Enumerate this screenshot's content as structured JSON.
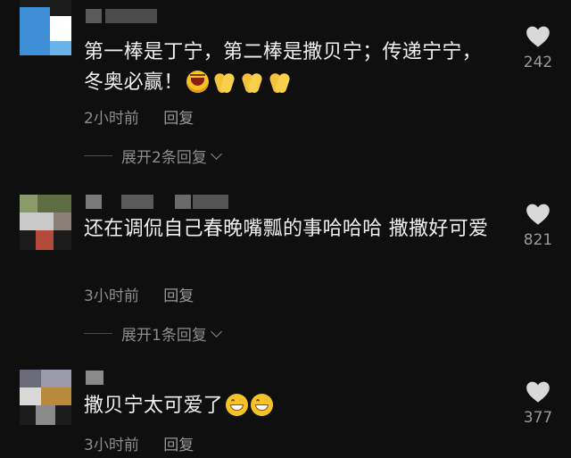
{
  "comments": [
    {
      "text": "第一棒是丁宁，第二棒是撒贝宁；传递宁宁，冬奥必赢！",
      "emojis": [
        "laugh-emoji",
        "clap-emoji",
        "clap-emoji",
        "clap-emoji"
      ],
      "time": "2小时前",
      "reply": "回复",
      "expand": "展开2条回复",
      "likes": "242",
      "colors": {
        "avatar": [
          "#3f8fd6",
          "#ffffff",
          "#6ab3ea"
        ]
      }
    },
    {
      "text": "还在调侃自己春晚嘴瓢的事哈哈哈 撒撒好可爱",
      "emojis": [],
      "time": "3小时前",
      "reply": "回复",
      "expand": "展开1条回复",
      "likes": "821",
      "colors": {
        "avatar": [
          "#7a8a5a",
          "#c9c9c9",
          "#b44a3a"
        ]
      }
    },
    {
      "text": "撒贝宁太可爱了",
      "emojis": [
        "grin-emoji",
        "grin-emoji"
      ],
      "time": "3小时前",
      "reply": "回复",
      "likes": "377",
      "colors": {
        "avatar": [
          "#7a7a8a",
          "#b88a3a",
          "#d9d9d9"
        ]
      }
    }
  ],
  "theme": {
    "background": "#0f0f10",
    "text": "#f0f0f0",
    "muted": "#8d8d8d",
    "heart": "#d9d9d9"
  },
  "icons": {
    "like": "heart-icon",
    "expand": "chevron-down-icon"
  }
}
